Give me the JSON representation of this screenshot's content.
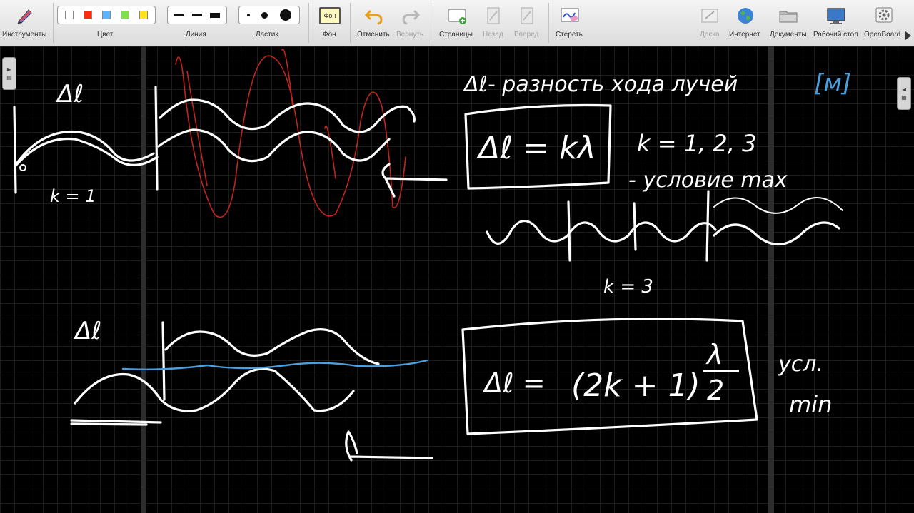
{
  "toolbar": {
    "tools_label": "Инструменты",
    "color_label": "Цвет",
    "line_label": "Линия",
    "eraser_label": "Ластик",
    "background_label": "Фон",
    "background_icon_text": "Фон",
    "undo_label": "Отменить",
    "redo_label": "Вернуть",
    "pages_label": "Страницы",
    "back_label": "Назад",
    "forward_label": "Вперед",
    "erase_label": "Стереть",
    "board_label": "Доска",
    "internet_label": "Интернет",
    "documents_label": "Документы",
    "desktop_label": "Рабочий стол",
    "openboard_label": "OpenBoard",
    "colors": [
      "#ffffff",
      "#ff2a10",
      "#5ab4ff",
      "#7ee04a",
      "#ffe41a"
    ]
  },
  "board": {
    "texts": {
      "delta_l_top": "Δℓ",
      "k1": "k = 1",
      "definition": "Δℓ- разность хода лучей",
      "unit": "[м]",
      "formula_max": "Δℓ = kλ",
      "k_values": "k = 1, 2, 3",
      "cond_max": "- условие max",
      "k3": "k = 3",
      "delta_l_bottom": "Δℓ",
      "formula_min_lhs": "Δℓ =",
      "formula_min_paren": "(2k + 1)",
      "formula_min_lambda": "λ",
      "formula_min_two": "2",
      "cond_min_1": "усл.",
      "cond_min_2": "min"
    },
    "accent_colors": {
      "ink": "#ffffff",
      "red": "#c0261c",
      "blue": "#4a9fe0"
    }
  }
}
